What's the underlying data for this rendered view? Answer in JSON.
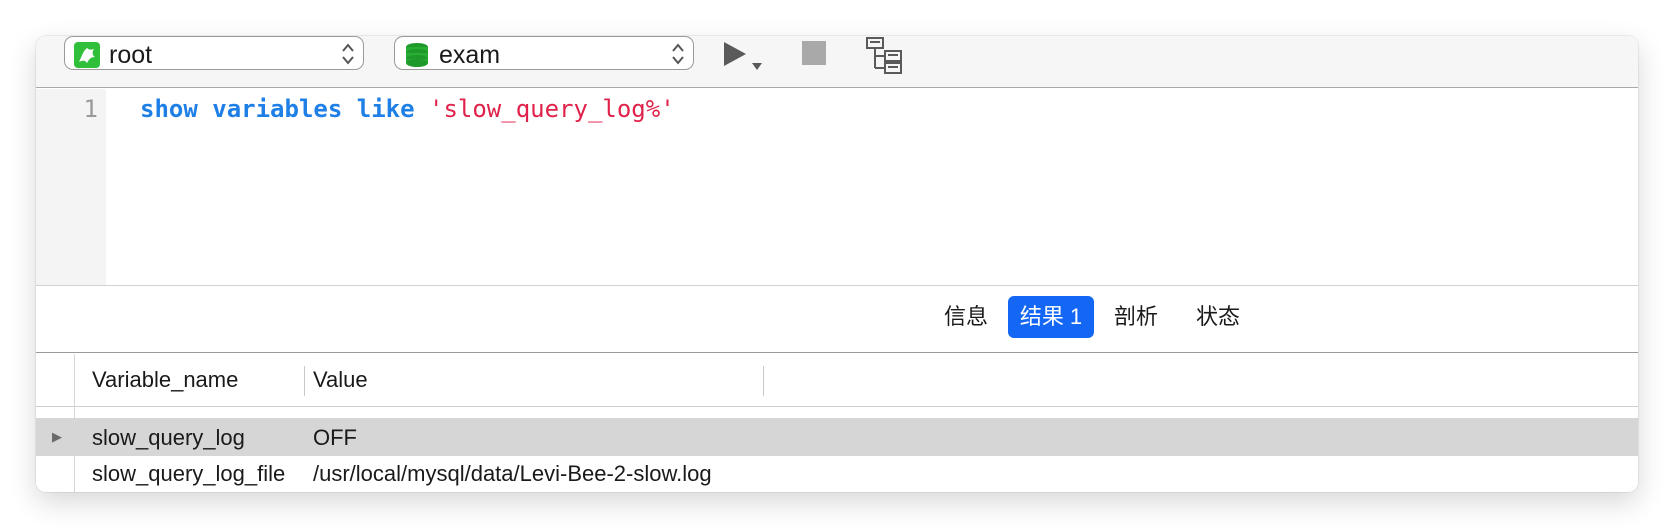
{
  "toolbar": {
    "user": "root",
    "database": "exam",
    "run_icon": "play-icon",
    "stop_icon": "stop-icon",
    "explain_icon": "tree-icon"
  },
  "editor": {
    "line_number": "1",
    "tokens": {
      "kw1": "show",
      "kw2": "variables",
      "kw3": "like",
      "str": "'slow_query_log%'"
    }
  },
  "tabs": [
    {
      "label": "信息"
    },
    {
      "label": "结果 1"
    },
    {
      "label": "剖析"
    },
    {
      "label": "状态"
    }
  ],
  "active_tab": "结果 1",
  "grid": {
    "columns": [
      "Variable_name",
      "Value"
    ],
    "rows": [
      [
        "slow_query_log",
        "OFF"
      ],
      [
        "slow_query_log_file",
        "/usr/local/mysql/data/Levi-Bee-2-slow.log"
      ]
    ],
    "row_marker": "▶"
  },
  "colors": {
    "keyword": "#1e7fe6",
    "string": "#e0224a",
    "accent": "#1467f5",
    "selected_row": "#d6d6d6"
  }
}
